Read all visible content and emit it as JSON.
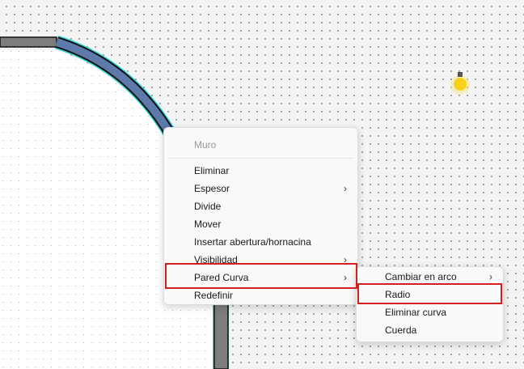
{
  "context_menu": {
    "header": "Muro",
    "items": [
      {
        "label": "Eliminar",
        "submenu": false
      },
      {
        "label": "Espesor",
        "submenu": true
      },
      {
        "label": "Divide",
        "submenu": false
      },
      {
        "label": "Mover",
        "submenu": false
      },
      {
        "label": "Insertar abertura/hornacina",
        "submenu": false
      },
      {
        "label": "Visibilidad",
        "submenu": true
      },
      {
        "label": "Pared Curva",
        "submenu": true,
        "highlighted": true
      },
      {
        "label": "Redefinir",
        "submenu": false
      }
    ]
  },
  "submenu": {
    "items": [
      {
        "label": "Cambiar en arco",
        "submenu": true
      },
      {
        "label": "Radio",
        "submenu": false,
        "highlighted": true
      },
      {
        "label": "Eliminar curva",
        "submenu": false
      },
      {
        "label": "Cuerda",
        "submenu": false
      }
    ]
  },
  "arrow_glyph": "›",
  "colors": {
    "wall_fill": "#5e7aab",
    "wall_outline": "#111111",
    "wall_selected_glow": "#36d6d6",
    "straight_wall": "#7d7d7d",
    "highlight_box": "#d21f1f",
    "light_bulb": "#f6d21a"
  }
}
